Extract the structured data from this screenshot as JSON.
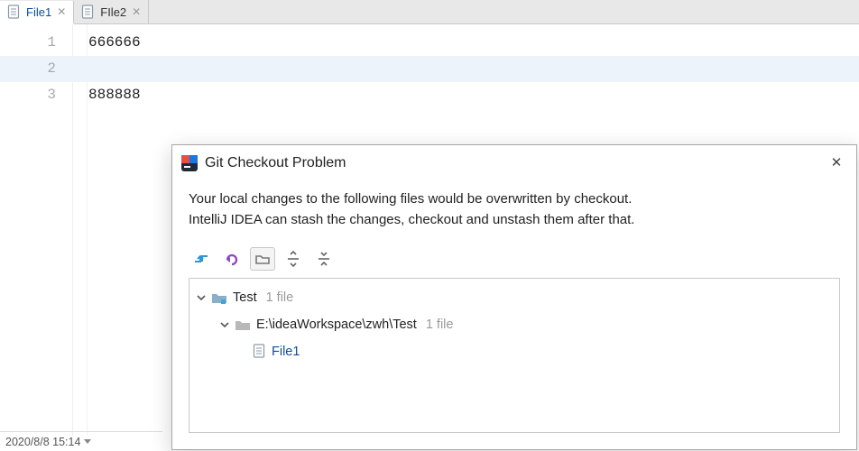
{
  "tabs": [
    {
      "label": "File1",
      "active": true
    },
    {
      "label": "FIle2",
      "active": false
    }
  ],
  "editor": {
    "lines": [
      {
        "n": "1",
        "text": "666666",
        "current": false
      },
      {
        "n": "2",
        "text": "",
        "current": true
      },
      {
        "n": "3",
        "text": "888888",
        "current": false
      }
    ]
  },
  "statusbar": {
    "datetime": "2020/8/8 15:14"
  },
  "dialog": {
    "title": "Git Checkout Problem",
    "message_line1": "Your local changes to the following files would be overwritten by checkout.",
    "message_line2": "IntelliJ IDEA can stash the changes, checkout and unstash them after that.",
    "toolbar_icons": {
      "merge": "merge-arrows-icon",
      "undo": "undo-icon",
      "group": "group-by-directory-icon",
      "expand": "expand-all-icon",
      "collapse": "collapse-all-icon"
    },
    "tree": {
      "root": {
        "name": "Test",
        "meta": "1 file"
      },
      "path": {
        "name": "E:\\ideaWorkspace\\zwh\\Test",
        "meta": "1 file"
      },
      "file": {
        "name": "File1"
      }
    }
  }
}
